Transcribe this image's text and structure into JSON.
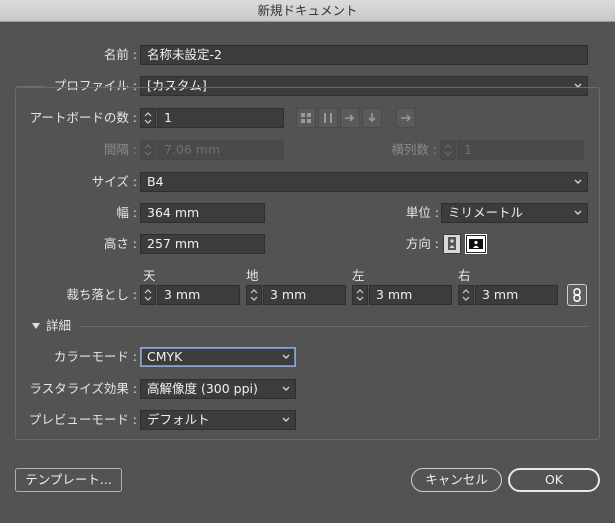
{
  "dialog": {
    "title": "新規ドキュメント"
  },
  "name": {
    "label": "名前 :",
    "value": "名称未設定-2"
  },
  "profile": {
    "label": "プロファイル :",
    "value": "[カスタム]"
  },
  "artboards": {
    "label": "アートボードの数 :",
    "value": "1"
  },
  "spacing": {
    "label": "間隔 :",
    "value": "7.06 mm"
  },
  "columns": {
    "label": "横列数 :",
    "value": "1"
  },
  "size": {
    "label": "サイズ :",
    "value": "B4"
  },
  "width": {
    "label": "幅 :",
    "value": "364 mm"
  },
  "height": {
    "label": "高さ :",
    "value": "257 mm"
  },
  "units": {
    "label": "単位 :",
    "value": "ミリメートル"
  },
  "orientation": {
    "label": "方向 :"
  },
  "bleed": {
    "label": "裁ち落とし :",
    "top": {
      "label": "天",
      "value": "3 mm"
    },
    "bottom": {
      "label": "地",
      "value": "3 mm"
    },
    "left": {
      "label": "左",
      "value": "3 mm"
    },
    "right": {
      "label": "右",
      "value": "3 mm"
    }
  },
  "advanced": {
    "label": "詳細",
    "color_mode": {
      "label": "カラーモード :",
      "value": "CMYK"
    },
    "raster_effects": {
      "label": "ラスタライズ効果 :",
      "value": "高解像度 (300 ppi)"
    },
    "preview_mode": {
      "label": "プレビューモード :",
      "value": "デフォルト"
    }
  },
  "buttons": {
    "templates": "テンプレート...",
    "cancel": "キャンセル",
    "ok": "OK"
  }
}
